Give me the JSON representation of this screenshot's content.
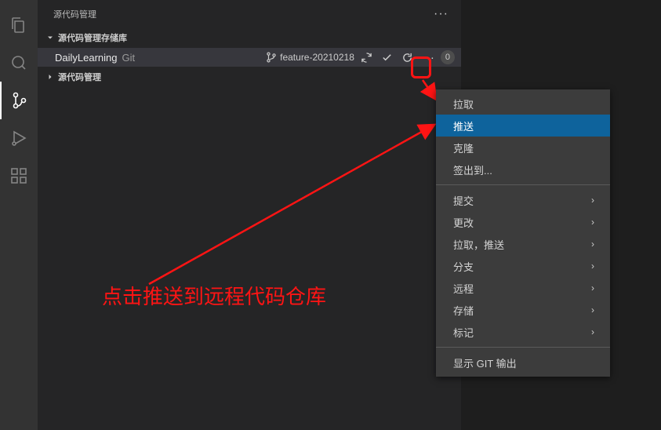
{
  "panel": {
    "title": "源代码管理"
  },
  "section": {
    "header": "源代码管理存储库"
  },
  "repo": {
    "name": "DailyLearning",
    "type": "Git",
    "branch": "feature-20210218",
    "count": "0"
  },
  "subsection": {
    "header": "源代码管理"
  },
  "menu": {
    "pull": "拉取",
    "push": "推送",
    "clone": "克隆",
    "checkout": "签出到...",
    "commit": "提交",
    "changes": "更改",
    "pull_push": "拉取，推送",
    "branch": "分支",
    "remote": "远程",
    "stash": "存储",
    "tags": "标记",
    "show_git_output": "显示 GIT 输出"
  },
  "annotation": {
    "text": "点击推送到远程代码仓库"
  }
}
